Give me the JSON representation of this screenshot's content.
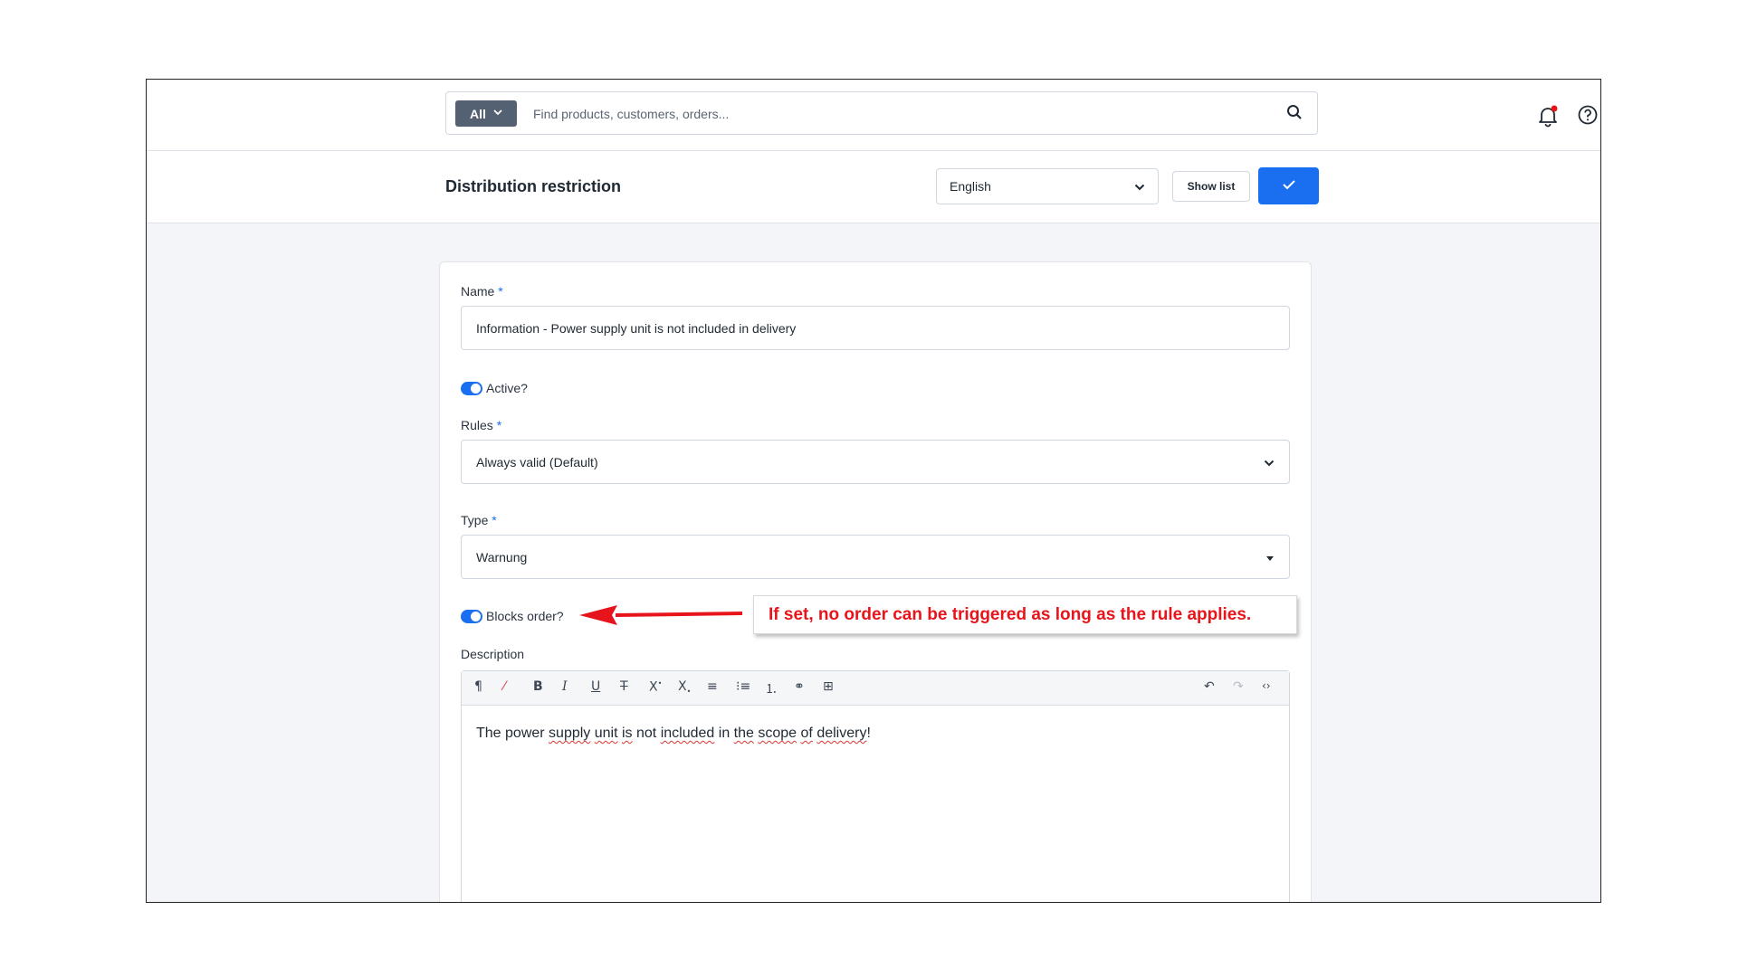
{
  "topbar": {
    "scope_label": "All",
    "search_placeholder": "Find products, customers, orders..."
  },
  "header": {
    "title": "Distribution restriction",
    "language": "English",
    "show_list_label": "Show list"
  },
  "form": {
    "name_label": "Name",
    "name_value": "Information - Power supply unit is not included in delivery",
    "active_label": "Active?",
    "active": true,
    "rules_label": "Rules",
    "rules_value": "Always valid (Default)",
    "type_label": "Type",
    "type_value": "Warnung",
    "blocks_label": "Blocks order?",
    "blocks": true,
    "description_label": "Description",
    "required_mark": "*",
    "description_words": {
      "w1": "The power ",
      "w2": "supply",
      "w3": " ",
      "w4": "unit",
      "w5": " ",
      "w6": "is",
      "w7": " not ",
      "w8": "included",
      "w9": " in ",
      "w10": "the",
      "w11": " ",
      "w12": "scope",
      "w13": " ",
      "w14": "of",
      "w15": " ",
      "w16": "delivery",
      "w17": "!"
    }
  },
  "annotation": {
    "text": "If set, no order can be triggered as long as the rule applies.",
    "color": "#e8141c"
  },
  "colors": {
    "accent": "#1a6ff0",
    "notification_dot": "#e8141c"
  }
}
